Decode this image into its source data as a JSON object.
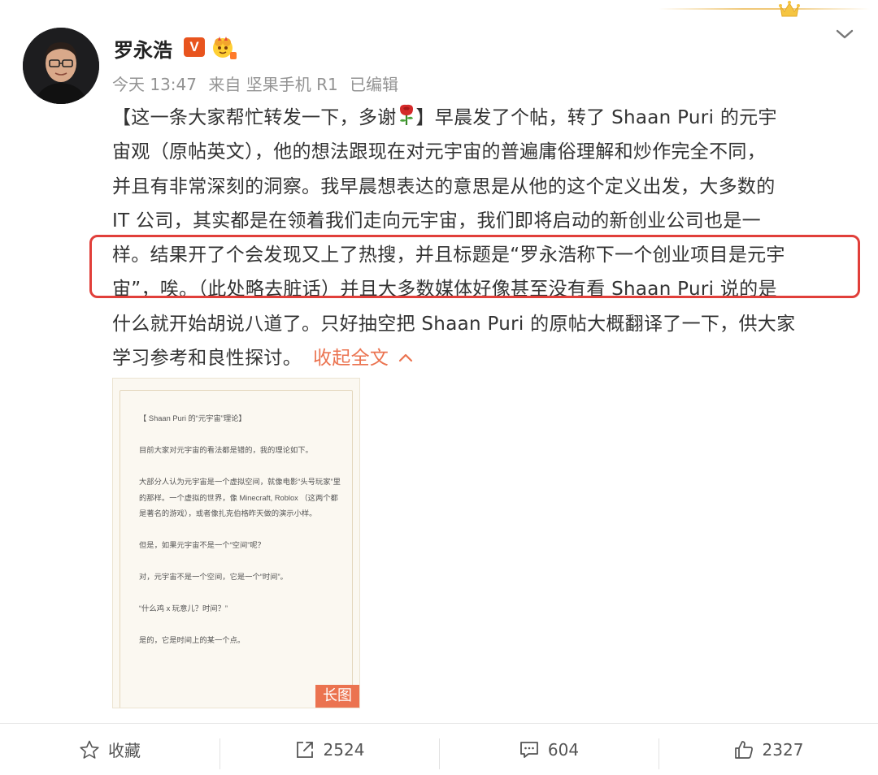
{
  "header": {
    "username": "罗永浩",
    "verified_badge": "V",
    "meta": {
      "time": "今天 13:47",
      "source": "来自 坚果手机 R1",
      "edited": "已编辑"
    }
  },
  "post": {
    "lines": [
      {
        "before": "【这一条大家帮忙转发一下，多谢",
        "icon": "rose-emoji",
        "after": "】早晨发了个帖，转了 Shaan Puri 的元宇"
      },
      {
        "text": "宙观（原帖英文），他的想法跟现在对元宇宙的普遍庸俗理解和炒作完全不同，"
      },
      {
        "text": "并且有非常深刻的洞察。我早晨想表达的意思是从他的这个定义出发，大多数的"
      },
      {
        "text": "IT 公司，其实都是在领着我们走向元宇宙，我们即将启动的新创业公司也是一"
      },
      {
        "text": "样。结果开了个会发现又上了热搜，并且标题是“罗永浩称下一个创业项目是元宇"
      },
      {
        "text": "宙”，唉。（此处略去脏话）并且大多数媒体好像甚至没有看 Shaan Puri 说的是"
      },
      {
        "text": "什么就开始胡说八道了。只好抽空把 Shaan Puri 的原帖大概翻译了一下，供大家"
      },
      {
        "text": "学习参考和良性探讨。"
      }
    ],
    "collapse_label": "收起全文"
  },
  "image": {
    "paragraphs": [
      "【 Shaan Puri 的“元宇宙”理论】",
      "目前大家对元宇宙的看法都是错的，我的理论如下。",
      "大部分人认为元宇宙是一个虚拟空间，就像电影“头号玩家”里的那样。一个虚拟的世界，像 Minecraft, Roblox （这两个都是著名的游戏），或者像扎克伯格昨天做的演示小样。",
      "但是，如果元宇宙不是一个“空间”呢？",
      "对，元宇宙不是一个空间，它是一个“时间”。",
      "“什么鸡 x 玩意儿？时间？”",
      "是的，它是时间上的某一个点。"
    ],
    "long_image_tag": "长图"
  },
  "actions": [
    {
      "name": "favorite",
      "icon": "star-icon",
      "label": "收藏"
    },
    {
      "name": "repost",
      "icon": "share-icon",
      "label": "2524"
    },
    {
      "name": "comment",
      "icon": "comment-icon",
      "label": "604"
    },
    {
      "name": "like",
      "icon": "thumbs-up-icon",
      "label": "2327"
    }
  ],
  "colors": {
    "accent": "#eb7350",
    "highlight_box": "#e13f3a",
    "verified_badge": "#e8541e",
    "meta_text": "#939393"
  }
}
